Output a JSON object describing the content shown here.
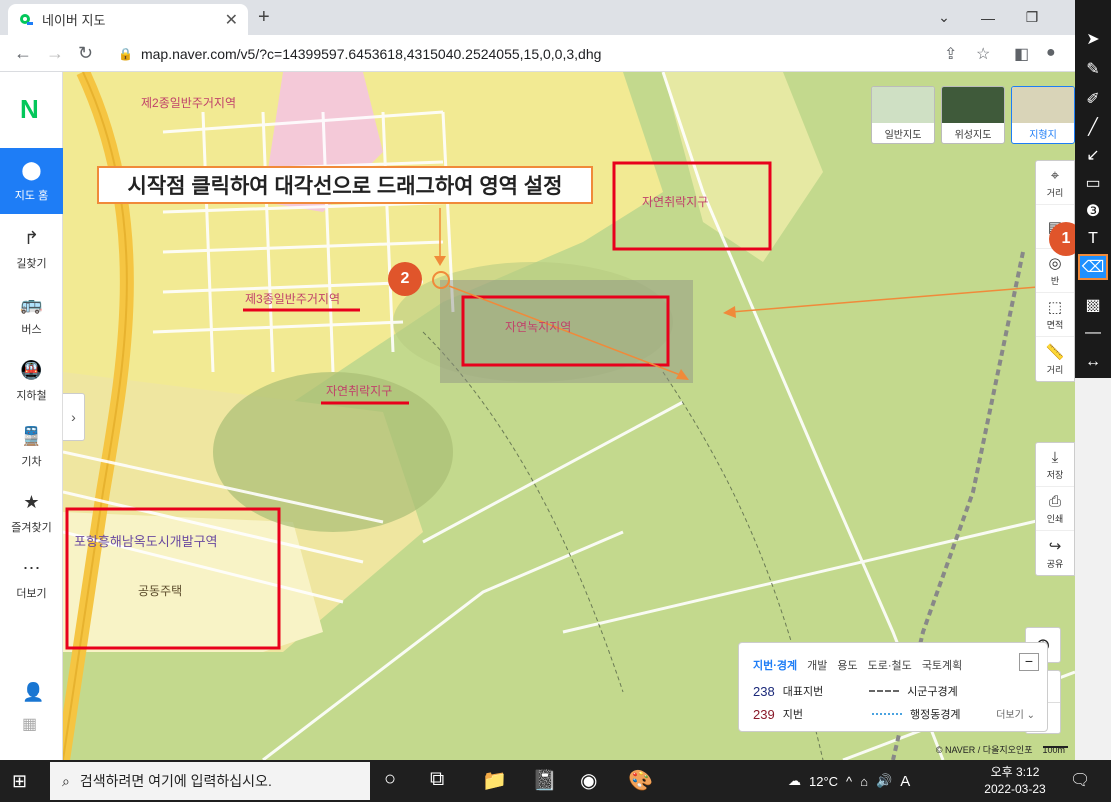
{
  "browser": {
    "tab_title": "네이버 지도",
    "url": "map.naver.com/v5/?c=14399597.6453618,4315040.2524055,15,0,0,3,dhg"
  },
  "leftnav": {
    "logo": "N",
    "items": [
      {
        "label": "지도 홈",
        "icon": "location-pin-icon"
      },
      {
        "label": "길찾기",
        "icon": "turn-arrow-icon"
      },
      {
        "label": "버스",
        "icon": "bus-icon"
      },
      {
        "label": "지하철",
        "icon": "subway-icon"
      },
      {
        "label": "기차",
        "icon": "train-icon"
      },
      {
        "label": "즐겨찾기",
        "icon": "star-icon"
      },
      {
        "label": "더보기",
        "icon": "more-dots-icon"
      }
    ]
  },
  "map": {
    "labels": {
      "zone2": "제2종일반주거지역",
      "zone3": "제3종일반주거지역",
      "village_left": "자연취락지구",
      "village_right": "자연취락지구",
      "green": "자연녹지지역",
      "dev_zone": "포항흥해남옥도시개발구역",
      "apartment": "공동주택"
    },
    "callout_text": "시작점 클릭하여 대각선으로 드래그하여 영역 설정",
    "badge1": "1",
    "badge2": "2",
    "map_types": [
      "일반지도",
      "위성지도",
      "지형지"
    ],
    "right_tools": [
      "거리",
      "반",
      "면적",
      "거리"
    ],
    "right_tools2": [
      "저장",
      "인쇄",
      "공유"
    ],
    "zoom_in": "+",
    "zoom_out": "−"
  },
  "legend": {
    "tabs": [
      "지번·경계",
      "개발",
      "용도",
      "도로·철도",
      "국토계획"
    ],
    "minimize": "−",
    "rows": [
      {
        "num": "238",
        "label": "대표지번",
        "line_label": "시군구경계"
      },
      {
        "num": "239",
        "label": "지번",
        "line_label": "행정동경계"
      }
    ],
    "more": "더보기 ⌄"
  },
  "copyright": {
    "text": "© NAVER / 다올지오인포",
    "scale": "100m"
  },
  "taskbar": {
    "search_placeholder": "검색하려면 여기에 입력하십시오.",
    "weather": "12°C",
    "ime": "A",
    "time": "오후 3:12",
    "date": "2022-03-23"
  },
  "colors": {
    "accent": "#1e7df6",
    "naver_green": "#03c75a",
    "highlight_red": "#e8001c",
    "arrow_orange": "#f08a3a"
  }
}
